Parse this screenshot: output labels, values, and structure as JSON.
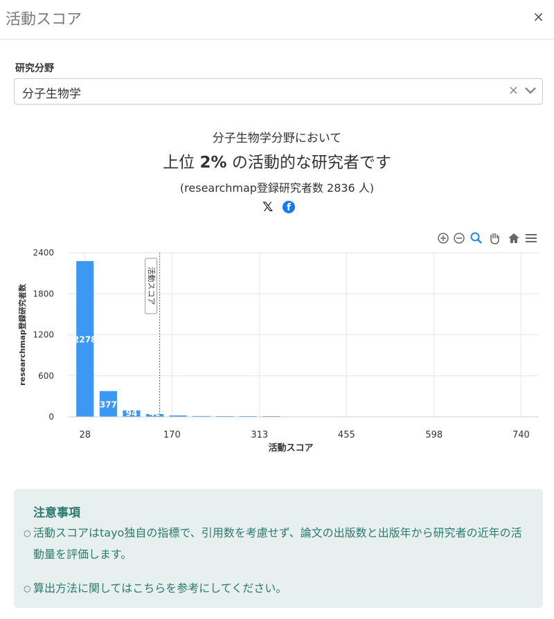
{
  "header": {
    "title": "活動スコア",
    "close_label": "×"
  },
  "field": {
    "label": "研究分野",
    "value": "分子生物学",
    "clear_label": "×"
  },
  "summary": {
    "line1": "分子生物学分野において",
    "line2_prefix": "上位 ",
    "line2_bold": "2%",
    "line2_suffix": " の活動的な研究者です",
    "line3": "(researchmap登録研究者数 2836 人)"
  },
  "share": {
    "x_label": "𝕏",
    "fb_label": "f"
  },
  "toolbar_icons": [
    "zoom-in-icon",
    "zoom-out-icon",
    "magnify-icon",
    "pan-hand-icon",
    "home-icon",
    "menu-icon"
  ],
  "chart_data": {
    "type": "bar",
    "xlabel": "活動スコア",
    "ylabel": "researchmap登録研究者数",
    "xlim": [
      0,
      769
    ],
    "ylim": [
      0,
      2400
    ],
    "x_ticks": [
      28,
      170,
      313,
      455,
      598,
      740
    ],
    "y_ticks": [
      0,
      600,
      1200,
      1800,
      2400
    ],
    "bar_color": "#3d98f4",
    "bin_width": 28.4,
    "bars": [
      {
        "x": 28,
        "value": 2278,
        "label": "2278"
      },
      {
        "x": 66,
        "value": 377,
        "label": "377"
      },
      {
        "x": 104,
        "value": 94,
        "label": "94"
      },
      {
        "x": 142,
        "value": 40,
        "label": "40"
      },
      {
        "x": 180,
        "value": 20,
        "label": ""
      },
      {
        "x": 218,
        "value": 12,
        "label": ""
      },
      {
        "x": 256,
        "value": 8,
        "label": ""
      },
      {
        "x": 294,
        "value": 4,
        "label": ""
      },
      {
        "x": 332,
        "value": 3,
        "label": ""
      }
    ],
    "marker": {
      "x": 150,
      "label": "活動スコア"
    }
  },
  "notes": {
    "heading": "注意事項",
    "items": [
      "活動スコアはtayo独自の指標で、引用数を考慮せず、論文の出版数と出版年から研究者の近年の活動量を評価します。",
      "算出方法に関してはこちらを参考にしてください。"
    ],
    "bullet": "○"
  }
}
